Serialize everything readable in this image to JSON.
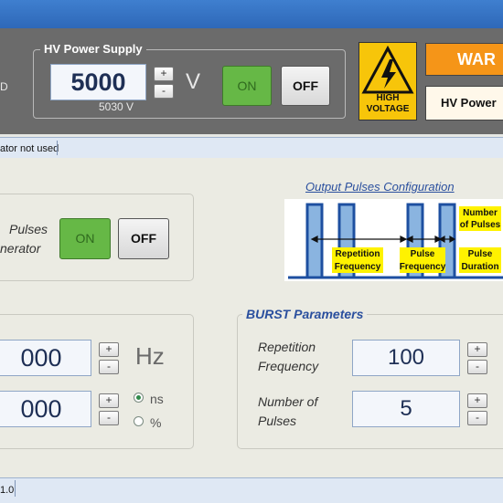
{
  "header": {
    "left_fragment": "D",
    "hv_power_supply": {
      "title": "HV Power Supply",
      "value": "5000",
      "readback": "5030 V",
      "unit": "V",
      "increment_label": "+",
      "decrement_label": "-",
      "on_label": "ON",
      "off_label": "OFF"
    },
    "high_voltage_icon": {
      "icon": "high-voltage-warning-icon",
      "line1": "HIGH",
      "line2": "VOLTAGE"
    },
    "warning": {
      "text": "WAR",
      "message": "HV Power"
    }
  },
  "status_bar": {
    "text": "ator not used"
  },
  "pulse_generator": {
    "label_line1": "Pulses",
    "label_line2": "nerator",
    "on_label": "ON",
    "off_label": "OFF"
  },
  "output_pulses": {
    "title": "Output Pulses Configuration",
    "labels": {
      "repetition_frequency": [
        "Repetition",
        "Frequency"
      ],
      "pulse_frequency": [
        "Pulse",
        "Frequency"
      ],
      "number_of_pulses": [
        "Number",
        "of Pulses"
      ],
      "pulse_duration": [
        "Pulse",
        "Duration"
      ]
    }
  },
  "pulse_params": {
    "frequency_value": "000",
    "frequency_unit": "Hz",
    "duration_value": "000",
    "unit_options": [
      "ns",
      "%"
    ],
    "selected_unit": "ns",
    "increment_label": "+",
    "decrement_label": "-"
  },
  "burst": {
    "title": "BURST Parameters",
    "repetition_label_line1": "Repetition",
    "repetition_label_line2": "Frequency",
    "repetition_value": "100",
    "number_label_line1": "Number of",
    "number_label_line2": "Pulses",
    "number_value": "5",
    "increment_label": "+",
    "decrement_label": "-"
  },
  "footer": {
    "version_fragment": "1.0"
  },
  "colors": {
    "title_bar": "#2e68b8",
    "header_bg": "#6b6b6b",
    "on_button": "#66b846",
    "warning_orange": "#f59518",
    "high_voltage_yellow": "#f7c50a",
    "accent_text": "#2a4f9e",
    "diagram_pulse": "#8ab4e0"
  }
}
